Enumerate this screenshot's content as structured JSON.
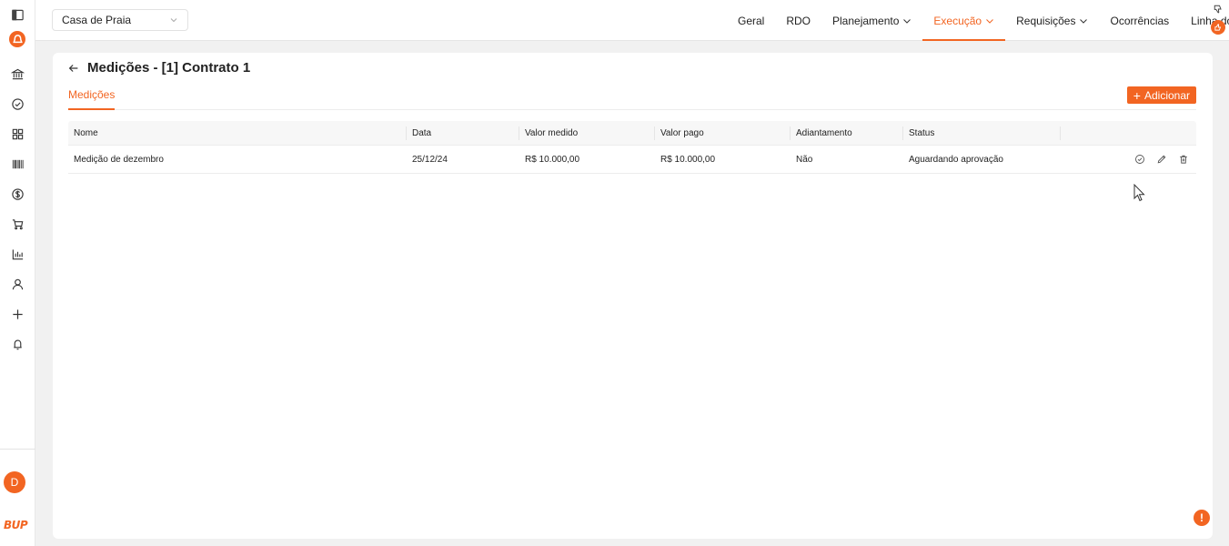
{
  "project": {
    "selected": "Casa de Praia"
  },
  "nav": {
    "items": [
      {
        "label": "Geral",
        "dropdown": false,
        "active": false
      },
      {
        "label": "RDO",
        "dropdown": false,
        "active": false
      },
      {
        "label": "Planejamento",
        "dropdown": true,
        "active": false
      },
      {
        "label": "Execução",
        "dropdown": true,
        "active": true
      },
      {
        "label": "Requisições",
        "dropdown": true,
        "active": false
      },
      {
        "label": "Ocorrências",
        "dropdown": false,
        "active": false
      },
      {
        "label": "Linha do Tempo",
        "dropdown": false,
        "active": false
      }
    ]
  },
  "sidebar": {
    "icons": [
      "panel-toggle-icon",
      "brand-badge-icon",
      "bank-icon",
      "check-circle-icon",
      "grid-icon",
      "barcode-icon",
      "dollar-icon",
      "cart-icon",
      "bar-chart-icon",
      "user-icon",
      "plus-icon",
      "bell-icon"
    ],
    "avatar_initial": "D",
    "brand": "BUP"
  },
  "page": {
    "title": "Medições - [1] Contrato 1",
    "tab_label": "Medições",
    "add_button_label": "Adicionar"
  },
  "table": {
    "columns": [
      "Nome",
      "Data",
      "Valor medido",
      "Valor pago",
      "Adiantamento",
      "Status",
      ""
    ],
    "rows": [
      {
        "nome": "Medição de dezembro",
        "data": "25/12/24",
        "valor_medido": "R$ 10.000,00",
        "valor_pago": "R$ 10.000,00",
        "adiantamento": "Não",
        "status": "Aguardando aprovação"
      }
    ]
  },
  "colors": {
    "accent": "#f26522",
    "background": "#f1f1f1",
    "card": "#ffffff"
  }
}
